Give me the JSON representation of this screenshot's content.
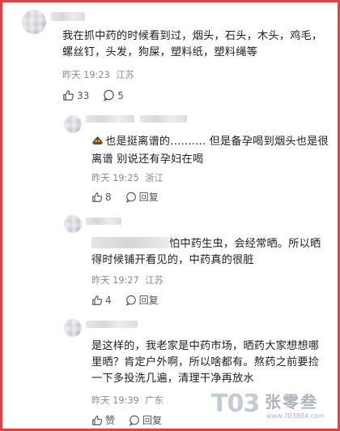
{
  "colors": {
    "frame_border": "#e0433f",
    "text": "#1f1f1f",
    "meta": "#8a8a8a"
  },
  "main_comment": {
    "text_line1": "我在抓中药的时候看到过，烟头，石头，木头，鸡毛，",
    "text_line2": "螺丝钉，头发，狗屎，塑料纸，塑料绳等",
    "time": "昨天 19:23",
    "location": "江苏",
    "like_count": "33",
    "reply_count": "5"
  },
  "replies": [
    {
      "emoji_icon": "poop-emoji-icon",
      "text_line1": "也是挺离谱的.......... 但是备孕喝到烟头也是很",
      "text_line2": "离谱 别说还有孕妇在喝",
      "time": "昨天 19:25",
      "location": "浙江",
      "like_count": "8",
      "reply_label": "回复"
    },
    {
      "text_line1": "怕中药生虫，会经常晒。所以晒",
      "text_line2": "得时候铺开看见的，中药真的很脏",
      "time": "昨天 19:27",
      "location": "江苏",
      "like_count": "4",
      "reply_label": "回复"
    },
    {
      "text_line1": "是这样的，我老家是中药市场，晒药大家想想哪",
      "text_line2": "里晒？肯定户外啊，所以啥都有。熬药之前要捡",
      "text_line3": "一下多投洗几遍，清理干净再放水",
      "time": "昨天 19:39",
      "location": "广东",
      "like_label": "赞",
      "reply_label": "回复"
    }
  ],
  "watermark": {
    "logo": "T03",
    "name": "张零叁",
    "url": "www.703804.com"
  }
}
